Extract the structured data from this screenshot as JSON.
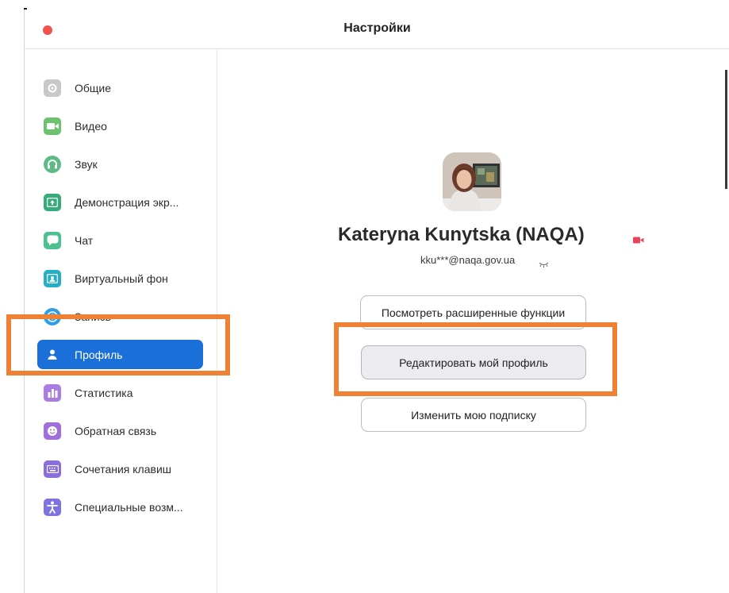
{
  "window": {
    "title": "Настройки"
  },
  "sidebar": {
    "items": [
      {
        "label": "Общие",
        "icon": "gear-icon",
        "color": "#c8c8c8"
      },
      {
        "label": "Видео",
        "icon": "video-camera-icon",
        "color": "#6cc26f"
      },
      {
        "label": "Звук",
        "icon": "headphones-icon",
        "color": "#5fbb86"
      },
      {
        "label": "Демонстрация экр...",
        "icon": "share-screen-icon",
        "color": "#34ad7a"
      },
      {
        "label": "Чат",
        "icon": "chat-icon",
        "color": "#4dc08f"
      },
      {
        "label": "Виртуальный фон",
        "icon": "virtual-background-icon",
        "color": "#23b0c4"
      },
      {
        "label": "Запись",
        "icon": "record-icon",
        "color": "#2f9ee6"
      },
      {
        "label": "Профиль",
        "icon": "profile-icon",
        "color": "#1a6fd9"
      },
      {
        "label": "Статистика",
        "icon": "statistics-icon",
        "color": "#a87fe0"
      },
      {
        "label": "Обратная связь",
        "icon": "feedback-icon",
        "color": "#9f6fdb"
      },
      {
        "label": "Сочетания клавиш",
        "icon": "keyboard-icon",
        "color": "#8a6fdc"
      },
      {
        "label": "Специальные возм...",
        "icon": "accessibility-icon",
        "color": "#7f73df"
      }
    ],
    "active_index": 7
  },
  "profile": {
    "name": "Kateryna Kunytska (NAQA)",
    "email": "kku***@naqa.gov.ua",
    "status_color": "#e8445a"
  },
  "actions": {
    "view_advanced_label": "Посмотреть расширенные функции",
    "edit_profile_label": "Редактировать мой профиль",
    "change_subscription_label": "Изменить мою подписку"
  },
  "annotations": {
    "highlight_color": "#ee8134"
  }
}
